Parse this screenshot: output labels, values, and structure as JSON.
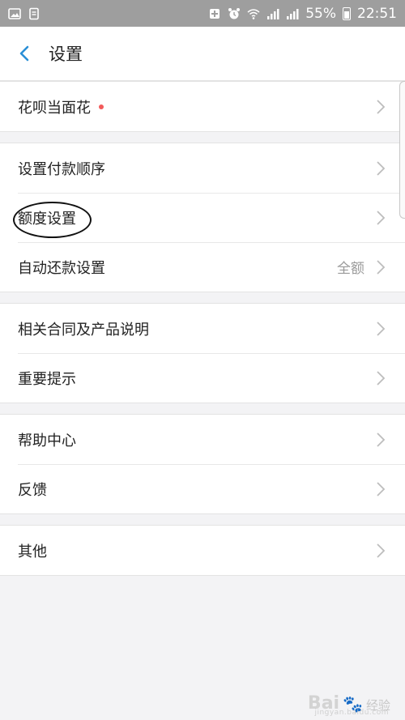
{
  "status_bar": {
    "battery_percent": "55%",
    "time": "22:51",
    "left_icons": [
      "image-icon",
      "document-icon"
    ],
    "right_icons": [
      "battery-saver-icon",
      "alarm-icon",
      "wifi-icon",
      "signal-icon",
      "signal-4g-icon"
    ]
  },
  "header": {
    "title": "设置"
  },
  "groups": [
    {
      "items": [
        {
          "label": "花呗当面花",
          "dot": true
        }
      ]
    },
    {
      "items": [
        {
          "label": "设置付款顺序"
        },
        {
          "label": "额度设置"
        },
        {
          "label": "自动还款设置",
          "value": "全额"
        }
      ]
    },
    {
      "items": [
        {
          "label": "相关合同及产品说明"
        },
        {
          "label": "重要提示"
        }
      ]
    },
    {
      "items": [
        {
          "label": "帮助中心"
        },
        {
          "label": "反馈"
        }
      ]
    },
    {
      "items": [
        {
          "label": "其他"
        }
      ]
    }
  ],
  "watermark": {
    "brand": "Bai",
    "brand_suffix": "经验",
    "url": "jingyan.baidu.com"
  },
  "colors": {
    "accent": "#2a8fd6",
    "status_bar": "#9e9e9e",
    "background": "#f3f3f5",
    "red_dot": "#f25a5a"
  }
}
